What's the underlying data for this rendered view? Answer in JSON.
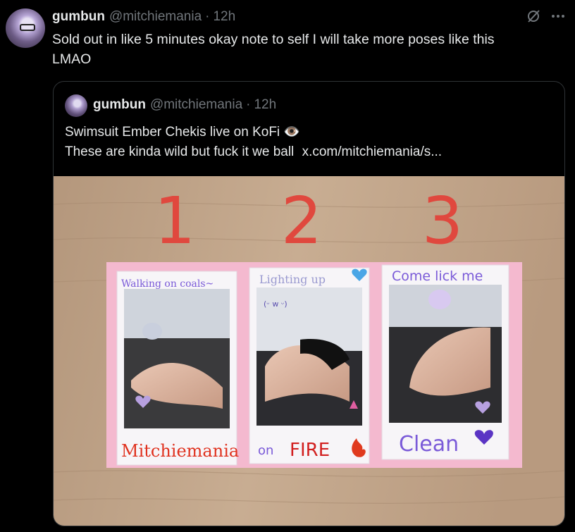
{
  "tweet": {
    "author_name": "gumbun",
    "handle": "@mitchiemania",
    "separator": "·",
    "time": "12h",
    "text_line1": "Sold out in like 5 minutes okay note to self I will take more poses like this",
    "text_line2": "LMAO"
  },
  "quote": {
    "author_name": "gumbun",
    "handle": "@mitchiemania",
    "separator": "·",
    "time": "12h",
    "text_line1": "Swimsuit Ember Chekis live on KoFi 👁️",
    "text_line2": "These are kinda wild but fuck it we ball",
    "link": "x.com/mitchiemania/s..."
  },
  "photo": {
    "numbers": [
      "1",
      "2",
      "3"
    ],
    "card1_top": "Walking on coals~",
    "card1_bottom": "Mitchiemania",
    "card2_top": "Lighting up",
    "card2_face": "(ᵕ w ᵕ)",
    "card2_bottom_a": "on",
    "card2_bottom_b": "FIRE",
    "card3_top": "Come lick me",
    "card3_bottom": "Clean"
  },
  "icons": [
    "no-grok-icon",
    "more-options-icon",
    "eye-emoji",
    "flame-sticker",
    "heart-sticker",
    "unicorn-sticker",
    "tulip-sticker"
  ],
  "colors": {
    "background": "#000000",
    "text": "#e7e9ea",
    "muted": "#71767b",
    "border": "#2f3336",
    "number_red": "#e0483e",
    "card_pink": "#f4b9cf",
    "purple_text": "#7a5ad8"
  }
}
